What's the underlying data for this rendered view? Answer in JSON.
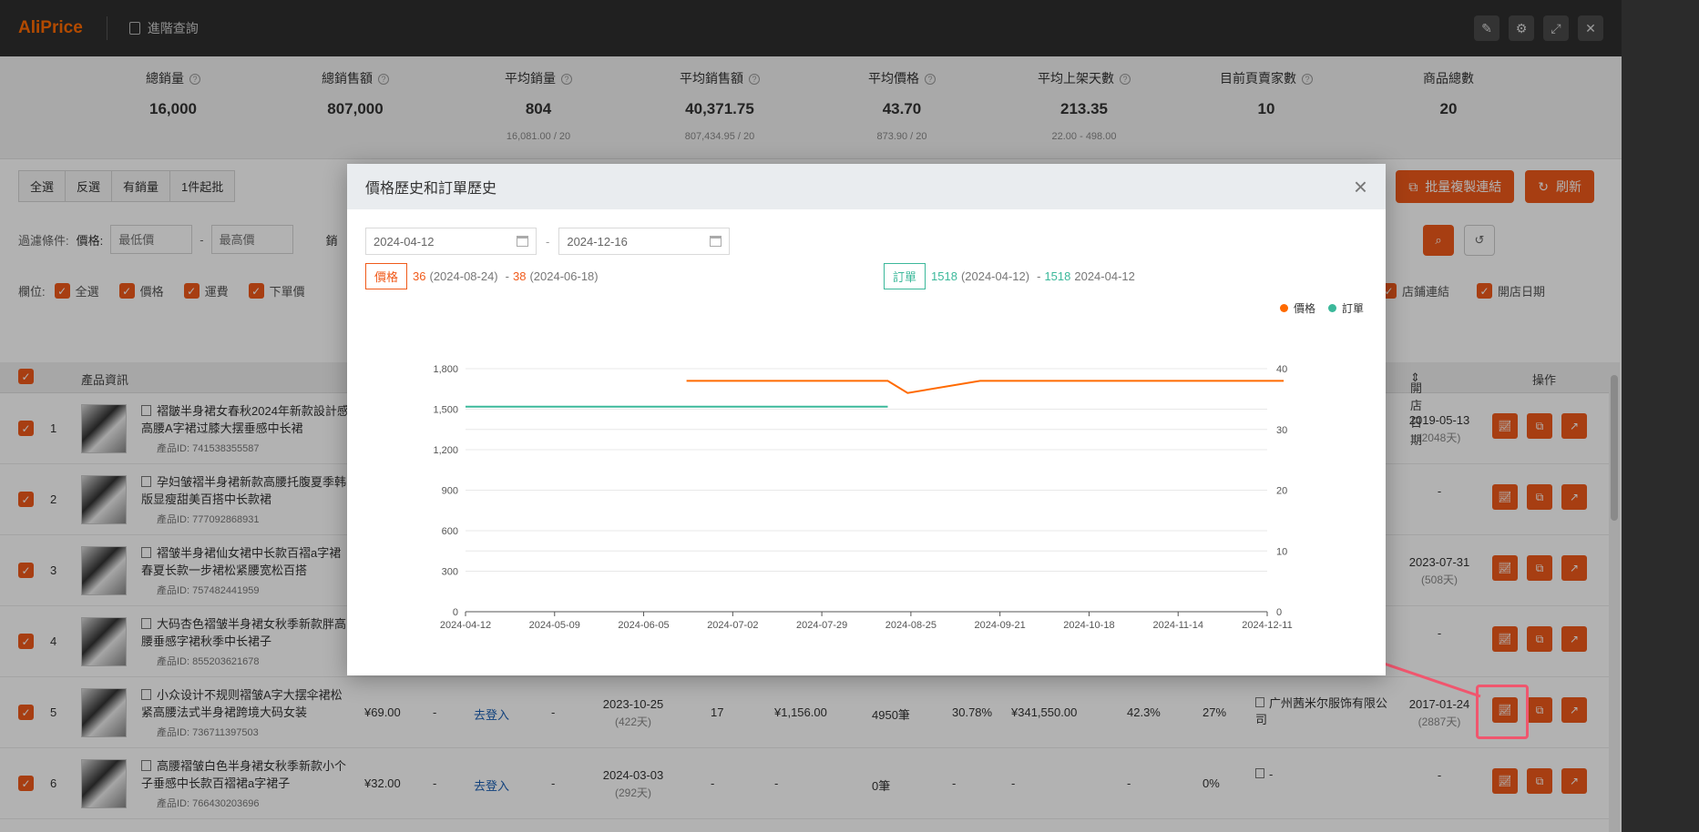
{
  "app": {
    "logo": "AliPrice",
    "doc_title": "進階查詢"
  },
  "titlebar_icons": [
    "edit-icon",
    "gear-icon",
    "expand-icon",
    "close-icon"
  ],
  "stats": [
    {
      "label": "總銷量",
      "value": "16,000",
      "sub": ""
    },
    {
      "label": "總銷售額",
      "value": "807,000",
      "sub": ""
    },
    {
      "label": "平均銷量",
      "value": "804",
      "sub": "16,081.00 / 20"
    },
    {
      "label": "平均銷售額",
      "value": "40,371.75",
      "sub": "807,434.95 / 20"
    },
    {
      "label": "平均價格",
      "value": "43.70",
      "sub": "873.90 / 20"
    },
    {
      "label": "平均上架天數",
      "value": "213.35",
      "sub": "22.00 - 498.00"
    },
    {
      "label": "目前頁賣家數",
      "value": "10",
      "sub": ""
    },
    {
      "label": "商品總數",
      "value": "20",
      "sub": ""
    }
  ],
  "toolbar": {
    "select_all": "全選",
    "invert": "反選",
    "has_sales": "有銷量",
    "moq": "1件起批"
  },
  "actions": {
    "batch_copy": "批量複製連結",
    "refresh": "刷新"
  },
  "filter": {
    "label": "過濾條件:",
    "price_label": "價格:",
    "min_placeholder": "最低價",
    "max_placeholder": "最高價",
    "sales_label_partial": "銷"
  },
  "columns": {
    "label": "欄位:",
    "items": [
      "全選",
      "價格",
      "運費",
      "下單價"
    ],
    "right_items": [
      "店鋪連結",
      "開店日期"
    ]
  },
  "table": {
    "headers": {
      "product": "產品資訊",
      "open_date": "開店日期",
      "ops": "操作"
    },
    "rows": [
      {
        "num": "1",
        "title": "褶皺半身裙女春秋2024年新款設計感高腰A字裙过膝大摆垂感中长裙",
        "pid": "產品ID: 741538355587",
        "price": "",
        "ship": "",
        "login": "",
        "dash": "",
        "created": "",
        "created_days": "",
        "sales": "",
        "amount": "",
        "orders": "",
        "rate1": "",
        "amount2": "",
        "rate2": "",
        "rate3": "",
        "store": "",
        "open": "2019-05-13",
        "open_days": "(2048天)"
      },
      {
        "num": "2",
        "title": "孕妇皱褶半身裙新款高腰托腹夏季韩版显瘦甜美百搭中长款裙",
        "pid": "產品ID: 777092868931",
        "price": "",
        "ship": "",
        "login": "",
        "dash": "",
        "created": "",
        "created_days": "",
        "sales": "",
        "amount": "",
        "orders": "",
        "rate1": "",
        "amount2": "",
        "rate2": "",
        "rate3": "",
        "store": "",
        "open": "-",
        "open_days": ""
      },
      {
        "num": "3",
        "title": "褶皱半身裙仙女裙中长款百褶a字裙春夏长款一步裙松紧腰宽松百搭",
        "pid": "產品ID: 757482441959",
        "price": "",
        "ship": "",
        "login": "",
        "dash": "",
        "created": "",
        "created_days": "",
        "sales": "",
        "amount": "",
        "orders": "",
        "rate1": "",
        "amount2": "",
        "rate2": "",
        "rate3": "",
        "store": "",
        "open": "2023-07-31",
        "open_days": "(508天)"
      },
      {
        "num": "4",
        "title": "大码杏色褶皱半身裙女秋季新款胖高腰垂感字裙秋季中长裙子",
        "pid": "產品ID: 855203621678",
        "price": "",
        "ship": "",
        "login": "",
        "dash": "",
        "created": "",
        "created_days": "",
        "sales": "",
        "amount": "",
        "orders": "",
        "rate1": "",
        "amount2": "",
        "rate2": "",
        "rate3": "",
        "store": "",
        "open": "-",
        "open_days": ""
      },
      {
        "num": "5",
        "title": "小众设计不规则褶皱A字大摆伞裙松紧高腰法式半身裙跨境大码女装",
        "pid": "產品ID: 736711397503",
        "price": "¥69.00",
        "ship": "-",
        "login": "去登入",
        "dash": "-",
        "created": "2023-10-25",
        "created_days": "(422天)",
        "sales": "17",
        "amount": "¥1,156.00",
        "orders": "4950筆",
        "rate1": "30.78%",
        "amount2": "¥341,550.00",
        "rate2": "42.3%",
        "rate3": "27%",
        "store": "广州茜米尔服饰有限公司",
        "open": "2017-01-24",
        "open_days": "(2887天)"
      },
      {
        "num": "6",
        "title": "高腰褶皱白色半身裙女秋季新款小个子垂感中长款百褶裙a字裙子",
        "pid": "產品ID: 766430203696",
        "price": "¥32.00",
        "ship": "-",
        "login": "去登入",
        "dash": "-",
        "created": "2024-03-03",
        "created_days": "(292天)",
        "sales": "-",
        "amount": "-",
        "orders": "0筆",
        "rate1": "-",
        "amount2": "-",
        "rate2": "-",
        "rate3": "0%",
        "store": "-",
        "open": "-",
        "open_days": ""
      }
    ]
  },
  "modal": {
    "title": "價格歷史和訂單歷史",
    "date_from": "2024-04-12",
    "date_sep": "-",
    "date_to": "2024-12-16",
    "price_tag": "價格",
    "price_min": "36",
    "price_min_date": "(2024-08-24)",
    "price_sep": "-",
    "price_max": "38",
    "price_max_date": "(2024-06-18)",
    "order_tag": "訂單",
    "order_min": "1518",
    "order_min_date": "(2024-04-12)",
    "order_sep": "-",
    "order_max": "1518",
    "order_max_date": "2024-04-12",
    "legend_price": "價格",
    "legend_order": "訂單",
    "colors": {
      "price": "#ff6a00",
      "order": "#3bb89a"
    }
  },
  "chart_data": {
    "type": "line",
    "title": "",
    "x": [
      "2024-04-12",
      "2024-05-09",
      "2024-06-05",
      "2024-07-02",
      "2024-07-29",
      "2024-08-25",
      "2024-09-21",
      "2024-10-18",
      "2024-11-14",
      "2024-12-11"
    ],
    "series": [
      {
        "name": "價格",
        "axis": "right",
        "points": [
          [
            "2024-06-18",
            38
          ],
          [
            "2024-08-18",
            38
          ],
          [
            "2024-08-24",
            36
          ],
          [
            "2024-09-15",
            38
          ],
          [
            "2024-12-16",
            38
          ]
        ]
      },
      {
        "name": "訂單",
        "axis": "left",
        "points": [
          [
            "2024-04-12",
            1518
          ],
          [
            "2024-08-18",
            1518
          ]
        ]
      }
    ],
    "y_left_ticks": [
      0,
      300,
      600,
      900,
      1200,
      1500,
      1800
    ],
    "y_left_labels": [
      "0",
      "300",
      "600",
      "900",
      "1,200",
      "1,500",
      "1,800"
    ],
    "y_right_ticks": [
      0,
      10,
      20,
      30,
      40
    ],
    "ylim_left": [
      0,
      1800
    ],
    "ylim_right": [
      0,
      40
    ],
    "grid": true,
    "legend": "top-right"
  }
}
